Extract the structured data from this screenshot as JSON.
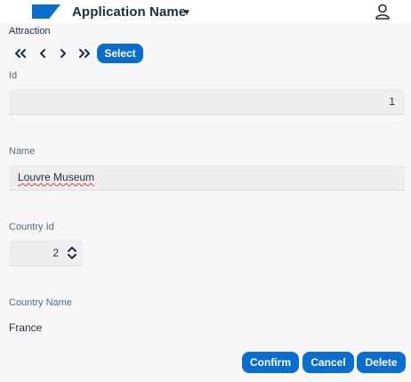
{
  "shell": {
    "app_name": "Application Name",
    "app_menu_icon": "triangle-down-icon",
    "user_icon": "person-icon",
    "brand_color": "#0a6ed1"
  },
  "section": {
    "title": "Attraction"
  },
  "navigation": {
    "first_icon": "double-chevron-left-icon",
    "previous_icon": "chevron-left-icon",
    "next_icon": "chevron-right-icon",
    "last_icon": "double-chevron-right-icon",
    "select_label": "Select"
  },
  "form": {
    "id_label": "Id",
    "id_value": "1",
    "name_label": "Name",
    "name_value": "Louvre Museum",
    "country_id_label": "Country Id",
    "country_id_value": "2",
    "country_id_stepper_icon": "up-down-chevron-icon",
    "country_name_label": "Country Name",
    "country_name_value": "France"
  },
  "actions": {
    "confirm_label": "Confirm",
    "cancel_label": "Cancel",
    "delete_label": "Delete"
  }
}
